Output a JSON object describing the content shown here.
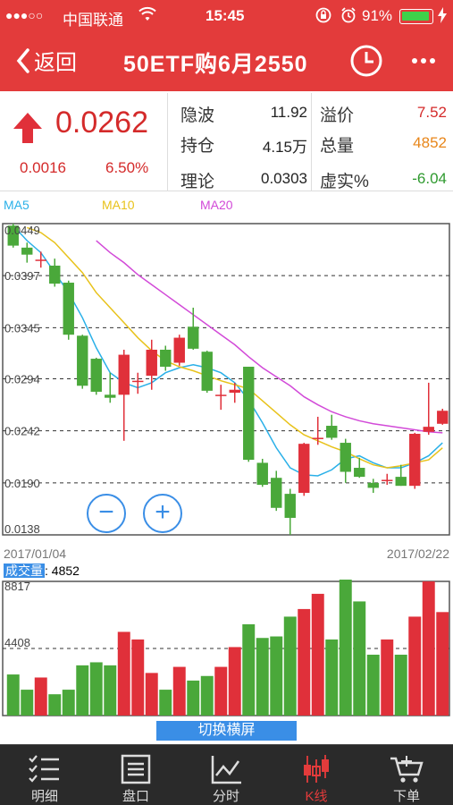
{
  "status_bar": {
    "signal": "●●●○○",
    "carrier": "中国联通",
    "time": "15:45",
    "battery_pct": "91%",
    "battery_level": 0.91
  },
  "nav": {
    "back_label": "返回",
    "title": "50ETF购6月2550"
  },
  "quote": {
    "price": "0.0262",
    "change": "0.0016",
    "change_pct": "6.50%",
    "fields": [
      {
        "label": "隐波",
        "value": "11.92",
        "color": "#222222"
      },
      {
        "label": "溢价",
        "value": "7.52",
        "color": "#d42a2a"
      },
      {
        "label": "持仓",
        "value": "4.15万",
        "color": "#222222"
      },
      {
        "label": "总量",
        "value": "4852",
        "color": "#e8861a"
      },
      {
        "label": "理论",
        "value": "0.0303",
        "color": "#222222"
      },
      {
        "label": "虚实%",
        "value": "-6.04",
        "color": "#2f9a2f"
      }
    ]
  },
  "legend": [
    {
      "label": "MA5",
      "color": "#2ab0e8"
    },
    {
      "label": "MA10",
      "color": "#e8c21a"
    },
    {
      "label": "MA20",
      "color": "#d24ad8"
    }
  ],
  "colors": {
    "up": "#e0303a",
    "down": "#4aa83a",
    "accent": "#3a8ee6"
  },
  "zoom": {
    "minus": "−",
    "plus": "+"
  },
  "dates": {
    "start": "2017/01/04",
    "end": "2017/02/22"
  },
  "volume": {
    "label": "成交量",
    "value": ": 4852"
  },
  "landscape_button": "切换横屏",
  "tabs": [
    {
      "label": "明细",
      "icon": "list-check-icon"
    },
    {
      "label": "盘口",
      "icon": "orderbook-icon"
    },
    {
      "label": "分时",
      "icon": "line-chart-icon"
    },
    {
      "label": "K线",
      "icon": "candlestick-icon"
    },
    {
      "label": "下单",
      "icon": "cart-icon"
    }
  ],
  "chart_data": [
    {
      "type": "candlestick",
      "yticks": [
        "0.0449",
        "0.0397",
        "0.0345",
        "0.0294",
        "0.0242",
        "0.0190",
        "0.0138"
      ],
      "ylim": [
        0.0138,
        0.0449
      ],
      "grid": true,
      "candles": [
        {
          "o": 0.0447,
          "h": 0.0449,
          "l": 0.0425,
          "c": 0.0427
        },
        {
          "o": 0.0425,
          "h": 0.043,
          "l": 0.041,
          "c": 0.0418
        },
        {
          "o": 0.0413,
          "h": 0.0421,
          "l": 0.0405,
          "c": 0.0413
        },
        {
          "o": 0.0407,
          "h": 0.0414,
          "l": 0.0386,
          "c": 0.0389
        },
        {
          "o": 0.039,
          "h": 0.0392,
          "l": 0.0333,
          "c": 0.0338
        },
        {
          "o": 0.0337,
          "h": 0.0338,
          "l": 0.0284,
          "c": 0.0287
        },
        {
          "o": 0.0314,
          "h": 0.0315,
          "l": 0.0278,
          "c": 0.0281
        },
        {
          "o": 0.0278,
          "h": 0.03,
          "l": 0.027,
          "c": 0.0275
        },
        {
          "o": 0.0278,
          "h": 0.0323,
          "l": 0.0232,
          "c": 0.0318
        },
        {
          "o": 0.0291,
          "h": 0.03,
          "l": 0.0279,
          "c": 0.0292
        },
        {
          "o": 0.0297,
          "h": 0.0333,
          "l": 0.0283,
          "c": 0.0323
        },
        {
          "o": 0.0323,
          "h": 0.0327,
          "l": 0.0302,
          "c": 0.0306
        },
        {
          "o": 0.031,
          "h": 0.0338,
          "l": 0.0307,
          "c": 0.0335
        },
        {
          "o": 0.0346,
          "h": 0.0365,
          "l": 0.0323,
          "c": 0.0324
        },
        {
          "o": 0.0321,
          "h": 0.0322,
          "l": 0.028,
          "c": 0.0282
        },
        {
          "o": 0.0278,
          "h": 0.0288,
          "l": 0.0263,
          "c": 0.0278
        },
        {
          "o": 0.028,
          "h": 0.029,
          "l": 0.027,
          "c": 0.0283
        },
        {
          "o": 0.0306,
          "h": 0.0306,
          "l": 0.0211,
          "c": 0.0213
        },
        {
          "o": 0.021,
          "h": 0.0214,
          "l": 0.0186,
          "c": 0.0188
        },
        {
          "o": 0.0195,
          "h": 0.0202,
          "l": 0.0162,
          "c": 0.0165
        },
        {
          "o": 0.0179,
          "h": 0.0184,
          "l": 0.0138,
          "c": 0.0155
        },
        {
          "o": 0.018,
          "h": 0.023,
          "l": 0.0177,
          "c": 0.0229
        },
        {
          "o": 0.0234,
          "h": 0.0256,
          "l": 0.0228,
          "c": 0.0235
        },
        {
          "o": 0.0247,
          "h": 0.0258,
          "l": 0.0233,
          "c": 0.0235
        },
        {
          "o": 0.023,
          "h": 0.0234,
          "l": 0.019,
          "c": 0.0201
        },
        {
          "o": 0.0205,
          "h": 0.0215,
          "l": 0.0195,
          "c": 0.0196
        },
        {
          "o": 0.019,
          "h": 0.0194,
          "l": 0.018,
          "c": 0.0185
        },
        {
          "o": 0.0192,
          "h": 0.0199,
          "l": 0.0188,
          "c": 0.0193
        },
        {
          "o": 0.0196,
          "h": 0.0208,
          "l": 0.0187,
          "c": 0.0187
        },
        {
          "o": 0.0187,
          "h": 0.024,
          "l": 0.0184,
          "c": 0.0239
        },
        {
          "o": 0.0241,
          "h": 0.029,
          "l": 0.0238,
          "c": 0.0246
        },
        {
          "o": 0.0249,
          "h": 0.0264,
          "l": 0.0248,
          "c": 0.0262
        }
      ],
      "ma5": [
        0.0447,
        0.0432,
        0.042,
        0.04,
        0.038,
        0.0355,
        0.0325,
        0.03,
        0.029,
        0.0285,
        0.029,
        0.03,
        0.0305,
        0.0308,
        0.0305,
        0.03,
        0.029,
        0.0273,
        0.025,
        0.0225,
        0.0205,
        0.0198,
        0.0197,
        0.0203,
        0.0214,
        0.0217,
        0.021,
        0.0205,
        0.0205,
        0.021,
        0.0217,
        0.023
      ],
      "ma10": [
        null,
        0.0445,
        0.044,
        0.043,
        0.0415,
        0.04,
        0.038,
        0.0365,
        0.035,
        0.0335,
        0.0322,
        0.0312,
        0.0306,
        0.0302,
        0.0297,
        0.0292,
        0.0288,
        0.0284,
        0.0272,
        0.026,
        0.0248,
        0.0238,
        0.0232,
        0.0226,
        0.0221,
        0.0214,
        0.0208,
        0.0205,
        0.0207,
        0.021,
        0.0213,
        0.0225
      ],
      "ma20": [
        null,
        null,
        null,
        null,
        null,
        null,
        0.0432,
        0.042,
        0.041,
        0.0398,
        0.0388,
        0.0378,
        0.0368,
        0.0358,
        0.0348,
        0.0338,
        0.0328,
        0.0316,
        0.0305,
        0.0296,
        0.0287,
        0.0276,
        0.0268,
        0.0261,
        0.0256,
        0.0252,
        0.0249,
        0.0247,
        0.0245,
        0.0243,
        0.0241,
        0.024
      ]
    },
    {
      "type": "bar",
      "name": "成交量",
      "yticks": [
        "8817",
        "4408"
      ],
      "ylim": [
        0,
        8817
      ],
      "values": [
        2700,
        1700,
        2500,
        1400,
        1700,
        3300,
        3500,
        3300,
        5500,
        5000,
        2800,
        1700,
        3200,
        2300,
        2600,
        3200,
        4500,
        6000,
        5100,
        5200,
        6500,
        7000,
        8000,
        5000,
        9000,
        7500,
        4000,
        5000,
        4000,
        6500,
        8817,
        6800
      ]
    }
  ]
}
